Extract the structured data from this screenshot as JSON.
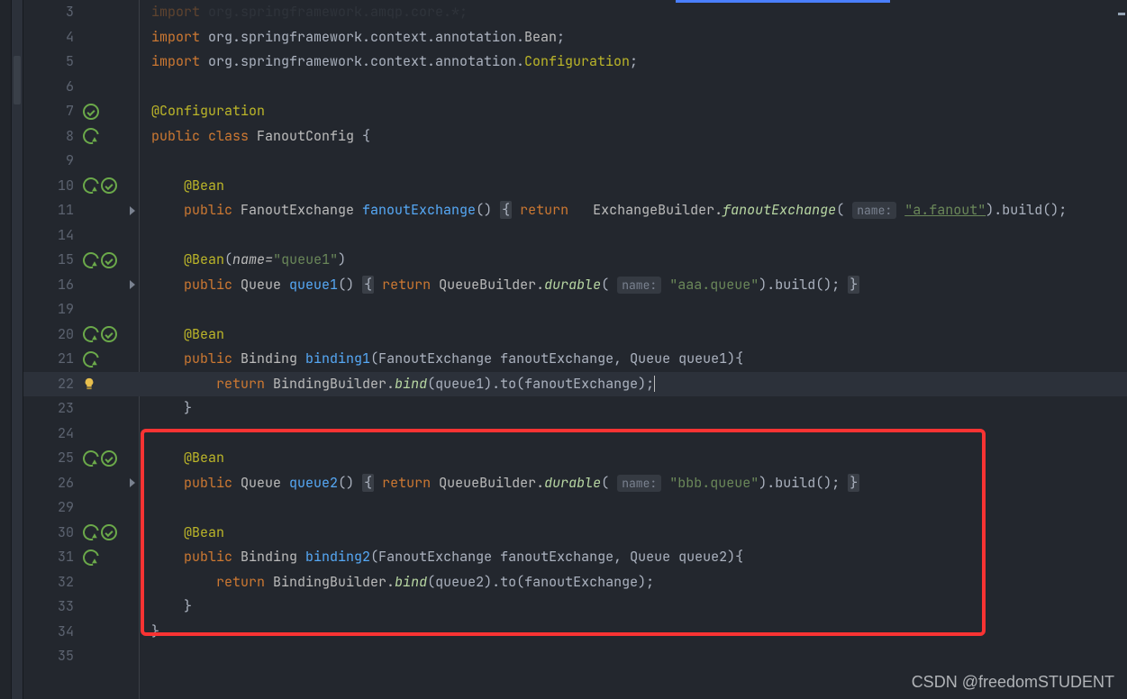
{
  "watermark": "CSDN @freedomSTUDENT",
  "code": {
    "import_partial": "import org.springframework.amqp.core.*;",
    "import1_pre": "import ",
    "import1_pkg": "org.springframework.context.annotation.",
    "import1_cls": "Bean",
    "import2_pre": "import ",
    "import2_pkg": "org.springframework.context.annotation.",
    "import2_cls": "Configuration",
    "anno_cfg": "@Configuration",
    "public": "public ",
    "class_kw": "class ",
    "cls_name": "FanoutConfig",
    "anno_bean": "@Bean",
    "anno_bean_named_pre": "@Bean",
    "anno_bean_named_paren_open": "(",
    "anno_bean_named_arg": "name=",
    "anno_bean_named_val": "\"queue1\"",
    "anno_bean_named_paren_close": ")",
    "fanoutExType": "FanoutExchange ",
    "fanoutExName": "fanoutExchange",
    "hint_name": "name:",
    "return": "return",
    "exBuilder": "ExchangeBuilder.",
    "fanoutExStatic": "fanoutExchange",
    "str_afanout": "\"a.fanout\"",
    "build_tail": ").build();",
    "queueType": "Queue ",
    "queue1": "queue1",
    "queueBuilder": "QueueBuilder.",
    "durable": "durable",
    "str_aaa": "\"aaa.queue\"",
    "bindingType": "Binding ",
    "binding1": "binding1",
    "binding1_params": "(FanoutExchange fanoutExchange, Queue queue1){",
    "bind_pre": "BindingBuilder.",
    "bind": "bind",
    "bind1_tail": "(queue1).to(fanoutExchange);",
    "queue2": "queue2",
    "str_bbb": "\"bbb.queue\"",
    "binding2": "binding2",
    "binding2_params": "(FanoutExchange fanoutExchange, Queue queue2){",
    "bind2_tail": "(queue2).to(fanoutExchange);"
  },
  "line_numbers": [
    "3",
    "4",
    "5",
    "6",
    "7",
    "8",
    "9",
    "10",
    "11",
    "14",
    "15",
    "16",
    "19",
    "20",
    "21",
    "22",
    "23",
    "24",
    "25",
    "26",
    "29",
    "30",
    "31",
    "32",
    "33",
    "34",
    "35"
  ]
}
